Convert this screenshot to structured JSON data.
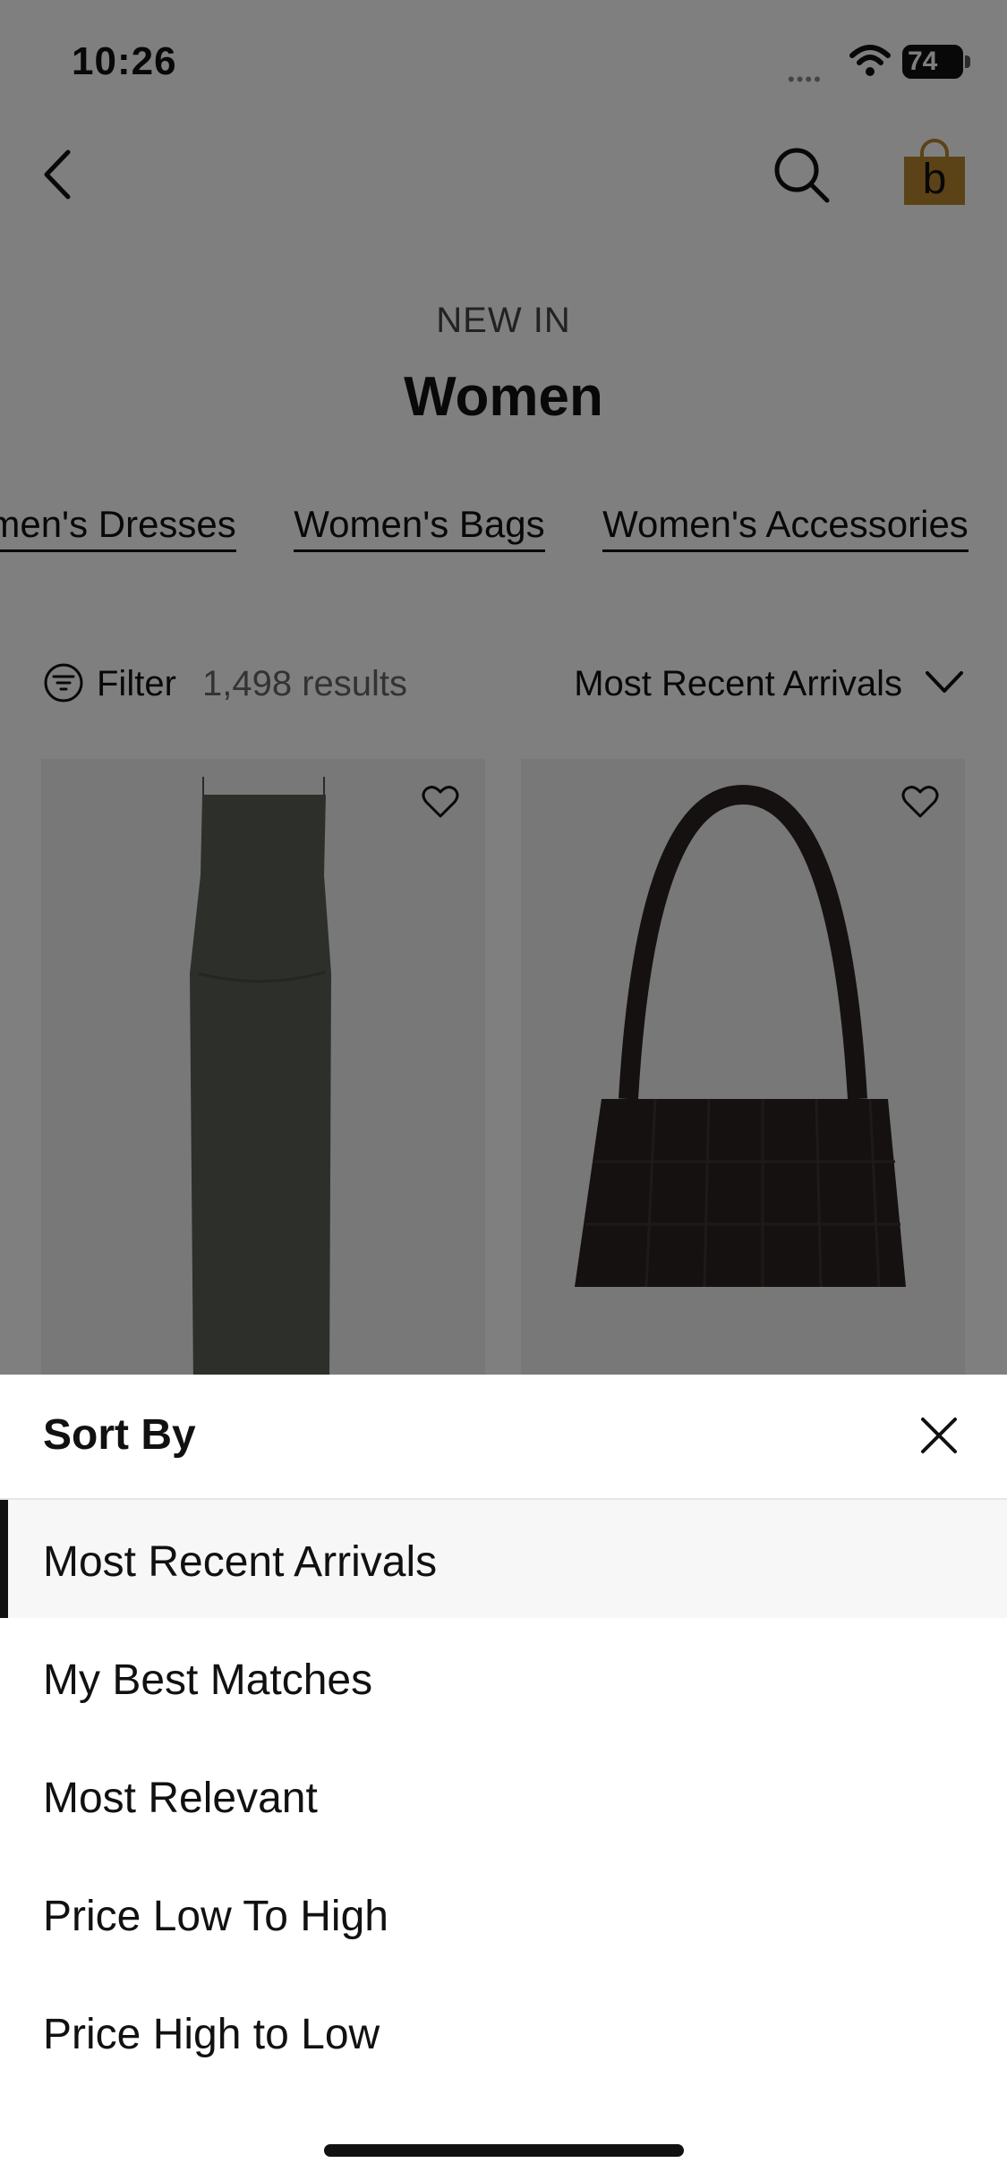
{
  "status_bar": {
    "time": "10:26",
    "battery": "74"
  },
  "header": {
    "subtitle": "NEW IN",
    "title": "Women",
    "bag_letter": "b"
  },
  "categories": [
    "omen's Dresses",
    "Women's Bags",
    "Women's Accessories"
  ],
  "toolbar": {
    "filter_label": "Filter",
    "results": "1,498 results",
    "sort_current": "Most Recent Arrivals"
  },
  "products": [
    {
      "name": "dress",
      "color": "#5b5e57"
    },
    {
      "name": "woven-bag",
      "color": "#2a2321"
    }
  ],
  "sort_sheet": {
    "title": "Sort By",
    "options": [
      {
        "label": "Most Recent Arrivals",
        "selected": true
      },
      {
        "label": "My Best Matches",
        "selected": false
      },
      {
        "label": "Most Relevant",
        "selected": false
      },
      {
        "label": "Price Low To High",
        "selected": false
      },
      {
        "label": "Price High to Low",
        "selected": false
      }
    ]
  },
  "colors": {
    "accent": "#111111",
    "bag_icon": "#b8872f",
    "overlay": "rgba(0,0,0,0.5)"
  }
}
